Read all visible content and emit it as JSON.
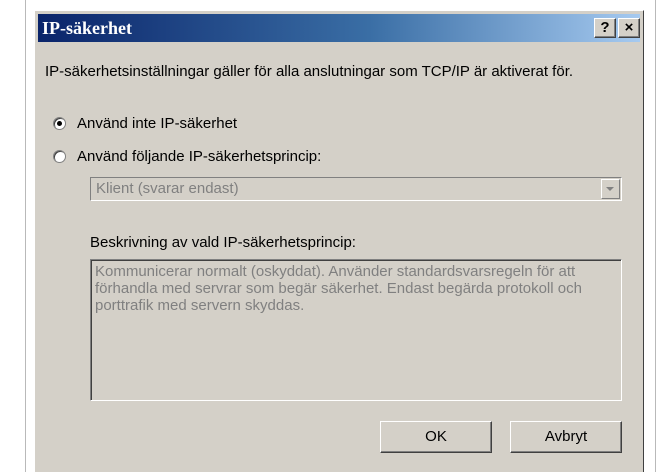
{
  "window": {
    "title": "IP-säkerhet",
    "help_label": "?",
    "close_label": "×"
  },
  "intro_text": "IP-säkerhetsinställningar gäller för alla anslutningar som TCP/IP är aktiverat för.",
  "options": [
    {
      "label": "Använd inte IP-säkerhet",
      "selected": true
    },
    {
      "label": "Använd följande IP-säkerhetsprincip:",
      "selected": false
    }
  ],
  "policy_select": {
    "value": "Klient (svarar endast)",
    "enabled": false
  },
  "description": {
    "label": "Beskrivning av vald IP-säkerhetsprincip:",
    "text": "Kommunicerar normalt (oskyddat). Använder standardsvarsregeln för att förhandla med servrar som begär säkerhet. Endast begärda protokoll och porttrafik med servern skyddas."
  },
  "buttons": {
    "ok": "OK",
    "cancel": "Avbryt"
  },
  "colors": {
    "titlebar_start": "#0a246a",
    "titlebar_end": "#a6caf0",
    "dialog_bg": "#d4d0c8",
    "disabled_text": "#808080"
  }
}
